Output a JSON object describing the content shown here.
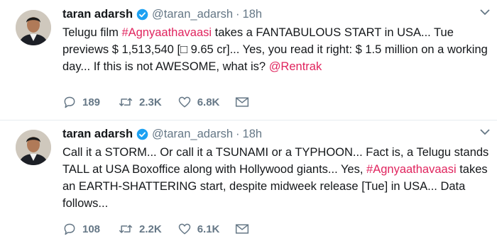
{
  "tweets": [
    {
      "name": "taran adarsh",
      "handle": "@taran_adarsh",
      "dot": "·",
      "time": "18h",
      "text_parts": [
        {
          "t": "Telugu film ",
          "link": false
        },
        {
          "t": "#Agnyaathavaasi",
          "link": true
        },
        {
          "t": " takes a FANTABULOUS START in USA... Tue previews $ 1,513,540 [□ 9.65 cr]... Yes, you read it right: $ 1.5 million on a working day... If this is not AWESOME, what is? ",
          "link": false
        },
        {
          "t": "@Rentrak",
          "link": true
        }
      ],
      "replies": "189",
      "retweets": "2.3K",
      "likes": "6.8K"
    },
    {
      "name": "taran adarsh",
      "handle": "@taran_adarsh",
      "dot": "·",
      "time": "18h",
      "text_parts": [
        {
          "t": "Call it a STORM... Or call it a TSUNAMI or a TYPHOON... Fact is, a Telugu stands TALL at USA Boxoffice along with Hollywood giants... Yes, ",
          "link": false
        },
        {
          "t": "#Agnyaathavaasi",
          "link": true
        },
        {
          "t": " takes an EARTH-SHATTERING start, despite midweek release [Tue] in USA... Data follows...",
          "link": false
        }
      ],
      "replies": "108",
      "retweets": "2.2K",
      "likes": "6.1K"
    }
  ],
  "icons": {
    "reply": "reply-icon",
    "retweet": "retweet-icon",
    "like": "heart-icon",
    "dm": "envelope-icon",
    "verified": "verified-badge-icon",
    "caret": "chevron-down-icon"
  },
  "colors": {
    "link": "#e0245e",
    "meta": "#657786",
    "verified": "#1da1f2"
  }
}
